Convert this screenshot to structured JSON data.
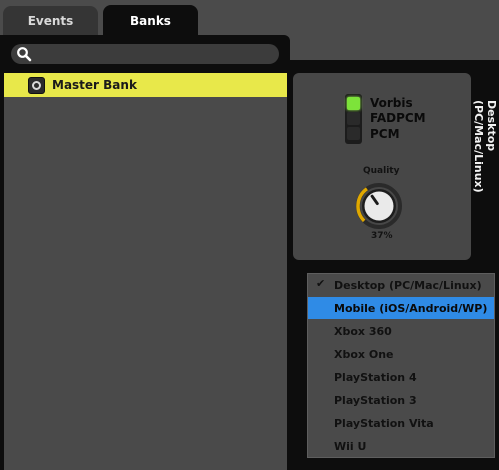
{
  "tabs": [
    {
      "label": "Events"
    },
    {
      "label": "Banks"
    }
  ],
  "search": {
    "value": ""
  },
  "banks": [
    {
      "label": "Master Bank"
    }
  ],
  "codecs": [
    {
      "label": "Vorbis",
      "active": true
    },
    {
      "label": "FADPCM",
      "active": false
    },
    {
      "label": "PCM",
      "active": false
    }
  ],
  "quality": {
    "label": "Quality",
    "value_text": "37%",
    "value": 0.37
  },
  "platform": {
    "label": "Desktop (PC/Mac/Linux)"
  },
  "platform_menu": {
    "selected": "Desktop (PC/Mac/Linux)",
    "check_glyph": "✔",
    "items": [
      {
        "label": "Desktop (PC/Mac/Linux)"
      },
      {
        "label": "Mobile (iOS/Android/WP)"
      },
      {
        "label": "Xbox 360"
      },
      {
        "label": "Xbox One"
      },
      {
        "label": "PlayStation 4"
      },
      {
        "label": "PlayStation 3"
      },
      {
        "label": "PlayStation Vita"
      },
      {
        "label": "Wii U"
      }
    ]
  },
  "colors": {
    "selected_item": "#e8e84a",
    "menu_highlight": "#2f8be6",
    "led_on": "#7de33a",
    "knob_arc": "#e0a800"
  }
}
